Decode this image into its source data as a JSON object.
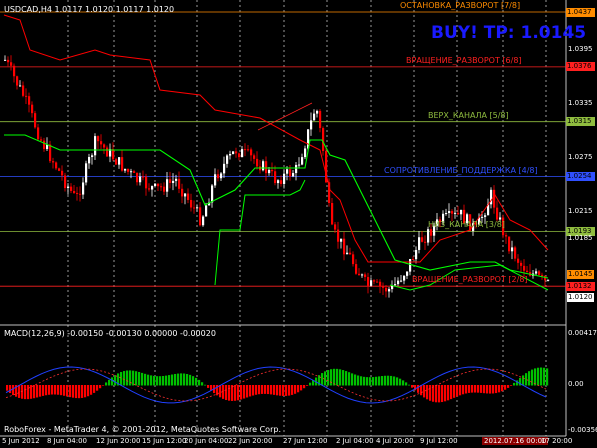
{
  "symbol_header": "USDCAD,H4  1.0117 1.0120 1.0117 1.0120",
  "signal": "BUY!  TP: 1.0145",
  "levels": [
    {
      "label": "ОСТАНОВКА_РАЗВОРОТ [7/8]",
      "price": "1.0437",
      "color": "#ff8c00"
    },
    {
      "label": "ВРАЩЕНИЕ_РАЗВОРОТ [6/8]",
      "price": "1.0376",
      "color": "#ff2020"
    },
    {
      "label": "ВЕРХ_КАНАЛА [5/8]",
      "price": "1.0315",
      "color": "#8fbc3f"
    },
    {
      "label": "СОПРОТИВЛЕНИЕ_ПОДДЕРЖКА [4/8]",
      "price": "1.0254",
      "color": "#3050ff"
    },
    {
      "label": "НИЗ_КАНАЛА [3/8]",
      "price": "1.0193",
      "color": "#8fbc3f"
    },
    {
      "label": "ВРАЩЕНИЕ_РАЗВОРОТ [2/8]",
      "price": "1.0132",
      "color": "#ff2020"
    }
  ],
  "price_axis": [
    "1.0437",
    "1.0395",
    "1.0376",
    "1.0335",
    "1.0315",
    "1.0275",
    "1.0254",
    "1.0215",
    "1.0193",
    "1.0185",
    "1.0145",
    "1.0132",
    "1.0120"
  ],
  "macd": {
    "header": "MACD(12,26,9) -0.00150 -0.00130 0.00000 -0.00020",
    "axis": [
      "0.00417",
      "0.00",
      "-0.00356"
    ]
  },
  "time_axis": [
    "5 Jun 2012",
    "8 Jun 04:00",
    "12 Jun 20:00",
    "15 Jun 12:00",
    "20 Jun 04:00",
    "22 Jun 20:00",
    "27 Jun 12:00",
    "2 Jul 04:00",
    "4 Jul 20:00",
    "9 Jul 12:00",
    "2012.07.16 00:00",
    "17 20:00"
  ],
  "footer": "RoboForex - MetaTrader 4, © 2001-2012, MetaQuotes Software Corp.",
  "colors": {
    "bull": "#ffffff",
    "bear": "#ff0000",
    "ma_green": "#00ff00",
    "ma_red": "#ff0000",
    "grid": "#ffffff"
  }
}
